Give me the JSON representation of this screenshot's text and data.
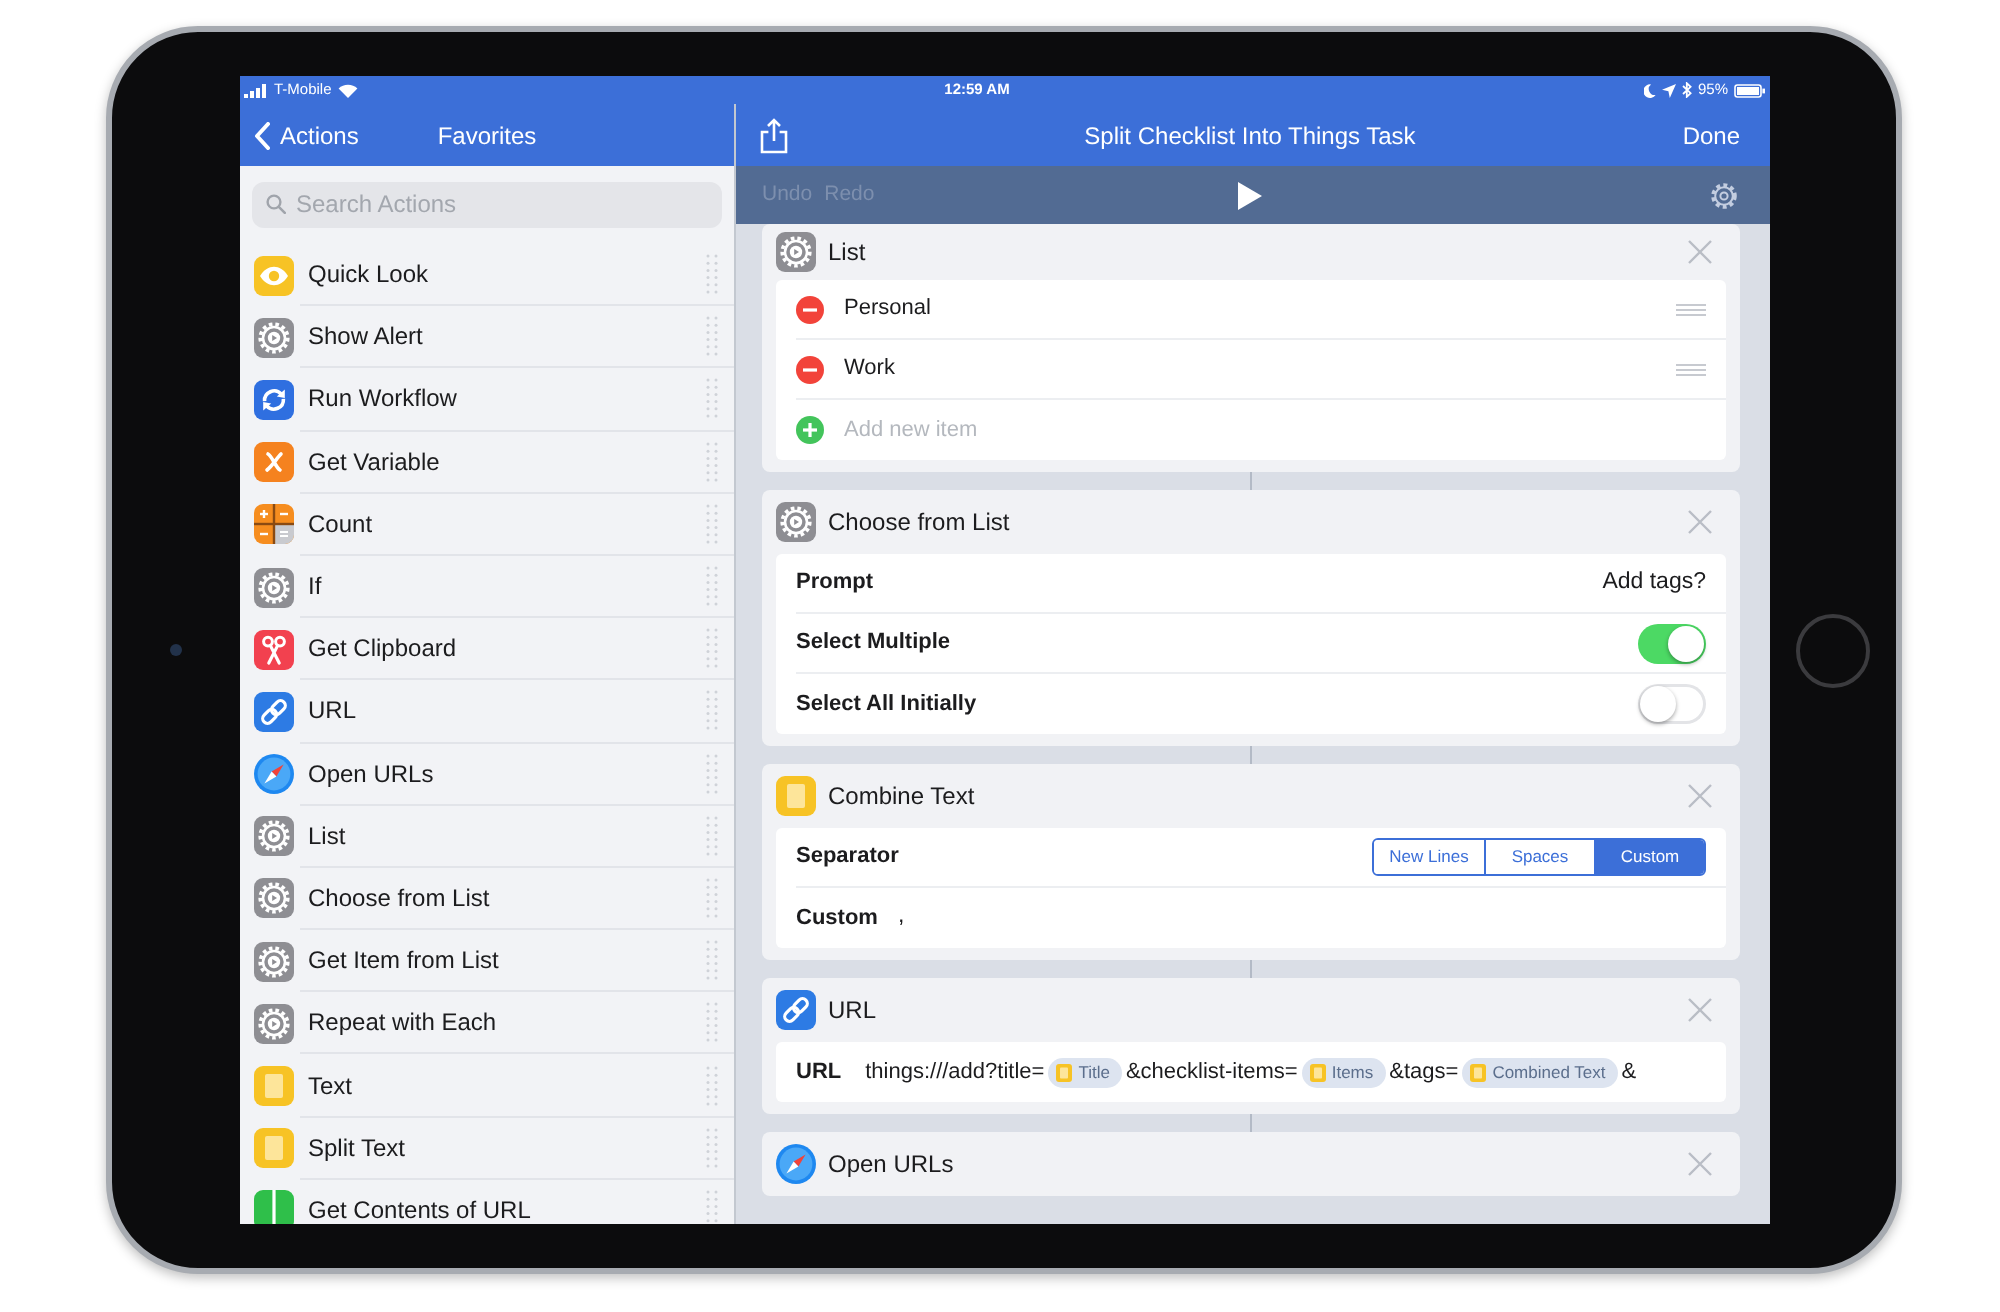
{
  "status_bar": {
    "carrier": "T-Mobile",
    "time": "12:59 AM",
    "battery": "95%"
  },
  "sidebar": {
    "back_button": "Actions",
    "title": "Favorites",
    "search": {
      "placeholder": "Search Actions"
    },
    "items": [
      {
        "label": "Quick Look",
        "kind": "preview"
      },
      {
        "label": "Show Alert",
        "kind": "scripting"
      },
      {
        "label": "Run Workflow",
        "kind": "workflow"
      },
      {
        "label": "Get Variable",
        "kind": "variable"
      },
      {
        "label": "Count",
        "kind": "calculation"
      },
      {
        "label": "If",
        "kind": "scripting"
      },
      {
        "label": "Get Clipboard",
        "kind": "clipboard"
      },
      {
        "label": "URL",
        "kind": "url"
      },
      {
        "label": "Open URLs",
        "kind": "browser"
      },
      {
        "label": "List",
        "kind": "scripting"
      },
      {
        "label": "Choose from List",
        "kind": "scripting"
      },
      {
        "label": "Get Item from List",
        "kind": "scripting"
      },
      {
        "label": "Repeat with Each",
        "kind": "scripting"
      },
      {
        "label": "Text",
        "kind": "text"
      },
      {
        "label": "Split Text",
        "kind": "text"
      },
      {
        "label": "Get Contents of URL",
        "kind": "web"
      }
    ]
  },
  "editor": {
    "title": "Split Checklist Into Things Task",
    "done_button": "Done",
    "toolbar": {
      "undo": {
        "label": "Undo",
        "disabled": true
      },
      "redo": {
        "label": "Redo",
        "disabled": true
      }
    },
    "actions": [
      {
        "kind": "scripting",
        "title": "List",
        "list_items": [
          {
            "label": "Personal"
          },
          {
            "label": "Work"
          }
        ],
        "new_item": {
          "placeholder": "Add new item"
        }
      },
      {
        "kind": "scripting",
        "title": "Choose from List",
        "rows": [
          {
            "kind": "detail",
            "label": "Prompt",
            "value": "Add tags?"
          },
          {
            "kind": "toggle",
            "label": "Select Multiple",
            "on": true
          },
          {
            "kind": "toggle",
            "label": "Select All Initially",
            "on": false
          }
        ]
      },
      {
        "kind": "text",
        "title": "Combine Text",
        "rows": [
          {
            "kind": "segmented",
            "label": "Separator",
            "options": [
              {
                "label": "New Lines",
                "selected": false
              },
              {
                "label": "Spaces",
                "selected": false
              },
              {
                "label": "Custom",
                "selected": true
              }
            ],
            "custom_field": {
              "label": "Custom",
              "value": ","
            }
          }
        ]
      },
      {
        "kind": "url",
        "title": "URL",
        "rows": [
          {
            "kind": "tokens",
            "label": "URL",
            "parts": [
              {
                "kind": "text",
                "text": "things:///add?title="
              },
              {
                "kind": "variable",
                "text": "Title"
              },
              {
                "kind": "text",
                "text": "&checklist-items="
              },
              {
                "kind": "variable",
                "text": "Items"
              },
              {
                "kind": "text",
                "text": "&tags="
              },
              {
                "kind": "variable",
                "text": "Combined Text"
              },
              {
                "kind": "text",
                "text": "&"
              }
            ]
          }
        ]
      },
      {
        "kind": "browser",
        "title": "Open URLs"
      }
    ]
  }
}
